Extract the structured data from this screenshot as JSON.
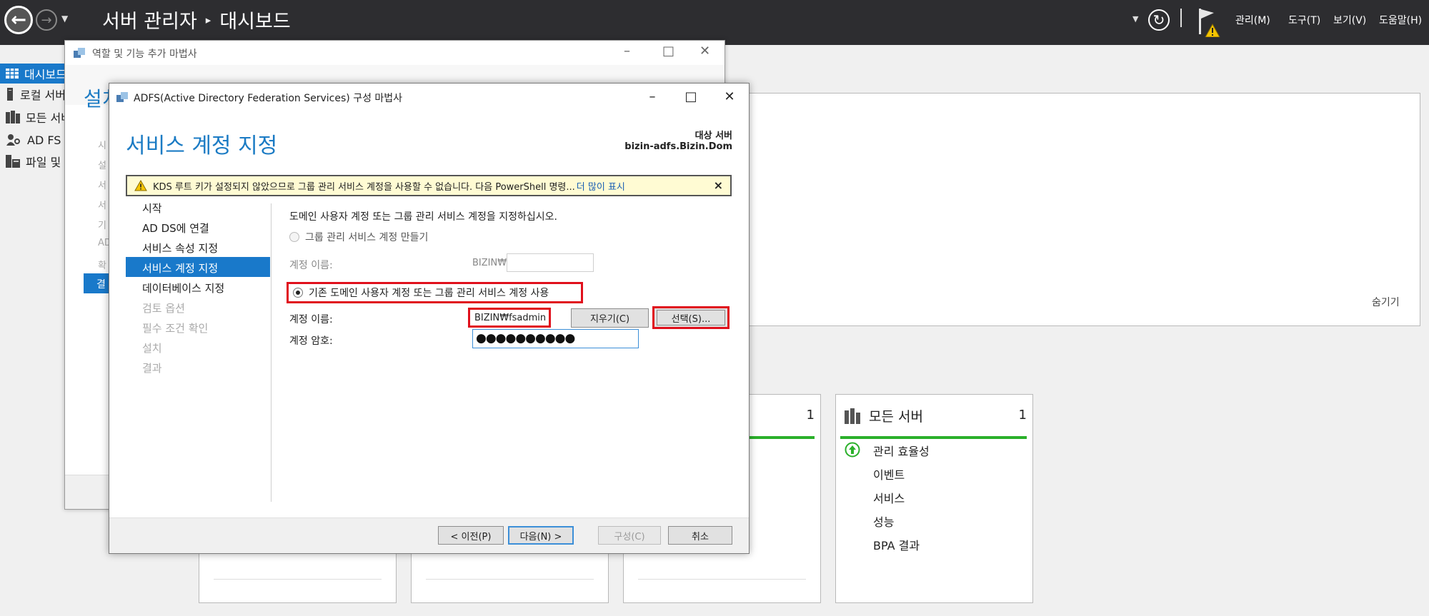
{
  "server_manager": {
    "title": "서버 관리자",
    "page": "대시보드",
    "menus": [
      "관리(M)",
      "도구(T)",
      "보기(V)",
      "도움말(H)"
    ],
    "nav": [
      {
        "label": "대시보드",
        "icon": "dashboard-icon",
        "active": true
      },
      {
        "label": "로컬 서버",
        "icon": "local-server-icon",
        "active": false
      },
      {
        "label": "모든 서버",
        "icon": "all-servers-icon",
        "active": false
      },
      {
        "label": "AD FS",
        "icon": "adfs-icon",
        "active": false
      },
      {
        "label": "파일 및 저장소 서비스",
        "icon": "file-storage-icon",
        "active": false
      }
    ],
    "hide_link": "숨기기",
    "tile_partial_count": "1",
    "all_servers_tile": {
      "title": "모든 서버",
      "count": "1",
      "rows": [
        "관리 효율성",
        "이벤트",
        "서비스",
        "성능",
        "BPA 결과"
      ]
    }
  },
  "roles_wizard": {
    "title": "역할 및 기능 추가 마법사",
    "heading": "설치",
    "steps": [
      "시",
      "설",
      "서",
      "서",
      "기",
      "AD",
      "확",
      "결"
    ],
    "active_step": "결"
  },
  "adfs_wizard": {
    "title": "ADFS(Active Directory Federation Services) 구성 마법사",
    "heading": "서비스 계정 지정",
    "target_label": "대상 서버",
    "target_server": "bizin-adfs.Bizin.Dom",
    "warning": {
      "text": "KDS 루트 키가 설정되지 않았으므로 그룹 관리 서비스 계정을 사용할 수 없습니다. 다음 PowerShell 명령...",
      "link": "더 많이 표시",
      "close": "×"
    },
    "steps": [
      {
        "label": "시작",
        "state": "normal"
      },
      {
        "label": "AD DS에 연결",
        "state": "normal"
      },
      {
        "label": "서비스 속성 지정",
        "state": "normal"
      },
      {
        "label": "서비스 계정 지정",
        "state": "active"
      },
      {
        "label": "데이터베이스 지정",
        "state": "normal"
      },
      {
        "label": "검토 옵션",
        "state": "disabled"
      },
      {
        "label": "필수 조건 확인",
        "state": "disabled"
      },
      {
        "label": "설치",
        "state": "disabled"
      },
      {
        "label": "결과",
        "state": "disabled"
      }
    ],
    "instruction": "도메인 사용자 계정 또는 그룹 관리 서비스 계정을 지정하십시오.",
    "option_gmsa": "그룹 관리 서비스 계정 만들기",
    "option_existing": "기존 도메인 사용자 계정 또는 그룹 관리 서비스 계정 사용",
    "account_label": "계정 이름:",
    "domain_prefix": "BIZIN₩",
    "account_value": "BIZIN₩fsadmin",
    "password_label": "계정 암호:",
    "password_value": "●●●●●●●●●●",
    "clear_button": "지우기(C)",
    "select_button": "선택(S)...",
    "buttons": {
      "prev": "< 이전(P)",
      "next": "다음(N) >",
      "configure": "구성(C)",
      "cancel": "취소"
    }
  }
}
